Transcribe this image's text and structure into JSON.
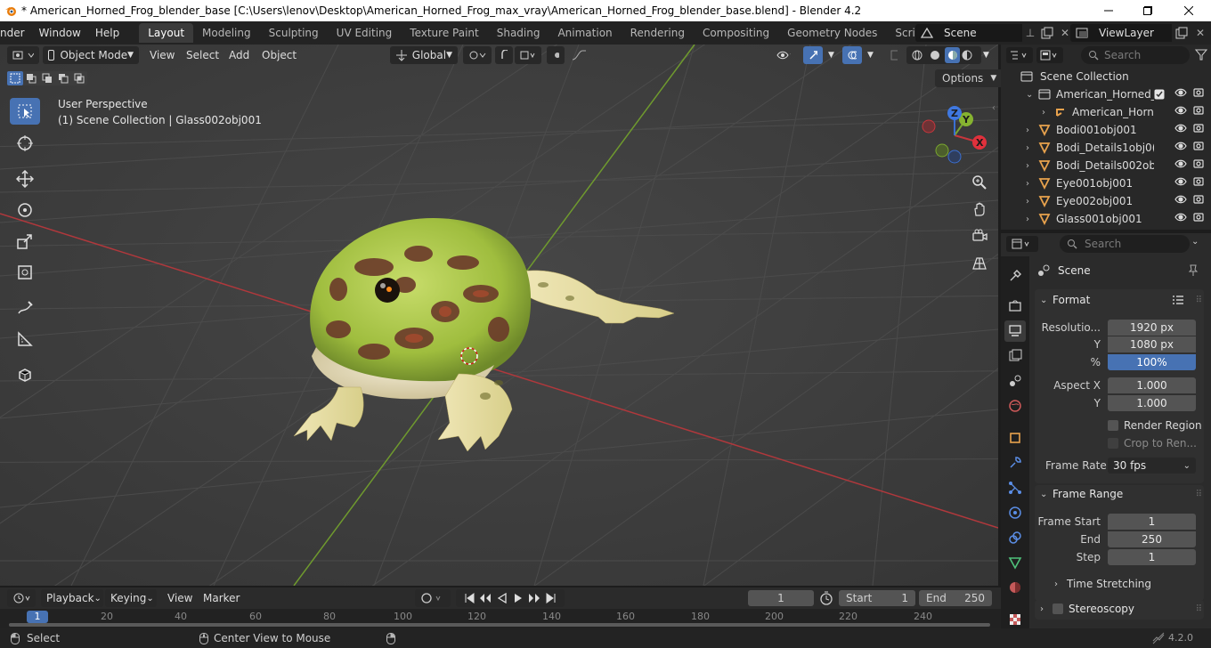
{
  "window": {
    "title": "* American_Horned_Frog_blender_base [C:\\Users\\lenov\\Desktop\\American_Horned_Frog_max_vray\\American_Horned_Frog_blender_base.blend] - Blender 4.2"
  },
  "menu": {
    "items": [
      "nder",
      "Window",
      "Help"
    ]
  },
  "workspaces": [
    "Layout",
    "Modeling",
    "Sculpting",
    "UV Editing",
    "Texture Paint",
    "Shading",
    "Animation",
    "Rendering",
    "Compositing",
    "Geometry Nodes",
    "Scripting"
  ],
  "active_workspace": "Layout",
  "scene": {
    "name": "Scene"
  },
  "view_layer": {
    "name": "ViewLayer"
  },
  "viewport_header": {
    "mode": "Object Mode",
    "menus": [
      "View",
      "Select",
      "Add",
      "Object"
    ],
    "orientation": "Global",
    "options_label": "Options"
  },
  "viewport": {
    "perspective": "User Perspective",
    "collection_info": "(1) Scene Collection | Glass002obj001",
    "gizmo": {
      "x": "X",
      "y": "Y",
      "z": "Z"
    }
  },
  "outliner": {
    "search_placeholder": "Search",
    "root": "Scene Collection",
    "rows": [
      {
        "label": "American_Horned_",
        "type": "collection"
      },
      {
        "label": "American_Horn",
        "type": "armature"
      },
      {
        "label": "Bodi001obj001",
        "type": "mesh"
      },
      {
        "label": "Bodi_Details1obj0(",
        "type": "mesh"
      },
      {
        "label": "Bodi_Details002ob",
        "type": "mesh"
      },
      {
        "label": "Eye001obj001",
        "type": "mesh"
      },
      {
        "label": "Eye002obj001",
        "type": "mesh"
      },
      {
        "label": "Glass001obj001",
        "type": "mesh"
      }
    ]
  },
  "properties": {
    "search_placeholder": "Search",
    "context": "Scene",
    "format": {
      "title": "Format",
      "resolution_label": "Resolutio...",
      "res_x": "1920 px",
      "y_label": "Y",
      "res_y": "1080 px",
      "pct_label": "%",
      "pct": "100%",
      "aspect_x_label": "Aspect X",
      "aspect_x": "1.000",
      "aspect_y_label": "Y",
      "aspect_y": "1.000",
      "render_region": "Render Region",
      "crop": "Crop to Ren...",
      "frame_rate_label": "Frame Rate",
      "frame_rate": "30 fps"
    },
    "frame_range": {
      "title": "Frame Range",
      "start_label": "Frame Start",
      "start": "1",
      "end_label": "End",
      "end": "250",
      "step_label": "Step",
      "step": "1",
      "time_stretching": "Time Stretching"
    },
    "stereoscopy": "Stereoscopy"
  },
  "timeline": {
    "menus": [
      "Playback",
      "Keying",
      "View",
      "Marker"
    ],
    "current_frame": "1",
    "start_label": "Start",
    "start": "1",
    "end_label": "End",
    "end": "250",
    "ticks": [
      "1",
      "20",
      "40",
      "60",
      "80",
      "100",
      "120",
      "140",
      "160",
      "180",
      "200",
      "220",
      "240"
    ]
  },
  "statusbar": {
    "select": "Select",
    "center": "Center View to Mouse",
    "version": "4.2.0"
  },
  "colors": {
    "accent": "#4772b3",
    "x_axis": "#c8363c",
    "y_axis": "#7aa630",
    "z_axis": "#3b6fd1"
  }
}
